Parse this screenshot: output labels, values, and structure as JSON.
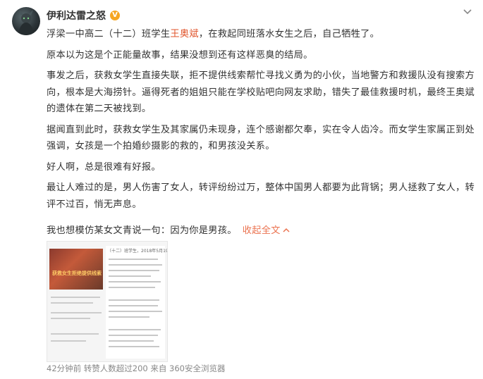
{
  "post": {
    "username": "伊利达雷之怒",
    "verified_badge": "V",
    "paragraphs": [
      {
        "before": "浮梁一中高二（十二）班学生",
        "highlight": "王奥斌",
        "after": "，在救起同班落水女生之后，自己牺牲了。"
      },
      {
        "before": "原本以为这是个正能量故事，结果没想到还有这样恶臭的结局。",
        "highlight": "",
        "after": ""
      },
      {
        "before": "事发之后，获救女学生直接失联，拒不提供线索帮忙寻找义勇为的小伙，当地警方和救援队没有搜索方向，根本是大海捞针。逼得死者的姐姐只能在学校贴吧向网友求助，错失了最佳救援时机，最终王奥斌的遗体在第二天被找到。",
        "highlight": "",
        "after": ""
      },
      {
        "before": "据闻直到此时，获救女学生及其家属仍未现身，连个感谢都欠奉，实在令人齿冷。而女学生家属正到处强调，女孩是一个拍婚纱摄影的救的，和男孩没关系。",
        "highlight": "",
        "after": ""
      },
      {
        "before": "好人啊，总是很难有好报。",
        "highlight": "",
        "after": ""
      },
      {
        "before": "最让人难过的是，男人伤害了女人，转评纷纷过万，整体中国男人都要为此背锅；男人拯救了女人，转评不过百，悄无声息。",
        "highlight": "",
        "after": ""
      }
    ],
    "closing": "我也想模仿某女文青说一句：因为你是男孩。",
    "collapse_label": "收起全文",
    "thumbnail": {
      "header": "（十二）班学生，2018年5月19",
      "caption": "获救女生拒绝提供线索"
    },
    "meta": "42分钟前 转赞人数超过200 来自 360安全浏览器"
  },
  "colors": {
    "accent": "#eb7350",
    "name_highlight": "#e0532a",
    "meta_text": "#888888",
    "badge": "#f6a623"
  },
  "icons": {
    "avatar": "avatar-dark-warrior",
    "menu": "chevron-down-icon",
    "collapse": "chevron-up-icon"
  }
}
